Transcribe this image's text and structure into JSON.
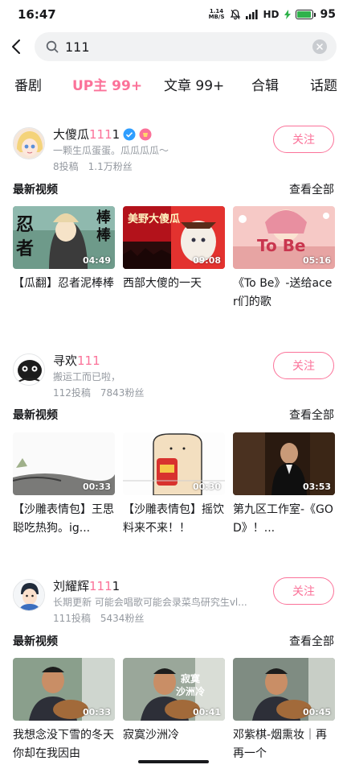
{
  "status_bar": {
    "time": "16:47",
    "speed_value": "1.14",
    "speed_unit": "MB/S",
    "hd": "HD",
    "battery": "95",
    "battery_level": 0.95,
    "battery_color": "#2fb24b"
  },
  "search": {
    "query": "111",
    "back_icon": "back-arrow-icon",
    "search_icon": "search-icon",
    "clear_icon": "clear-icon"
  },
  "tabs": [
    {
      "label": "番剧",
      "active": false
    },
    {
      "label": "UP主 99+",
      "active": true
    },
    {
      "label": "文章 99+",
      "active": false
    },
    {
      "label": "合辑",
      "active": false
    },
    {
      "label": "话题",
      "active": false
    }
  ],
  "accent_color": "#fb7299",
  "results": [
    {
      "name_prefix": "大傻瓜",
      "name_highlight": "111",
      "name_suffix": "1",
      "signature": "一颗生瓜蛋蛋。瓜瓜瓜瓜～",
      "videos_count": "8投稿",
      "fans": "1.1万粉丝",
      "follow_label": "关注",
      "section_title": "最新视频",
      "see_all": "查看全部",
      "videos": [
        {
          "title": "【瓜翻】忍者泥棒棒",
          "duration": "04:49",
          "thumb_text": [
            "忍",
            "者",
            "泥",
            "棒",
            "棒"
          ]
        },
        {
          "title": "西部大傻的一天",
          "duration": "09:08",
          "thumb_text": [
            "美野大傻瓜"
          ]
        },
        {
          "title": "《To Be》-送给acer们的歌",
          "duration": "05:16",
          "thumb_text": [
            "To Be"
          ]
        }
      ]
    },
    {
      "name_prefix": "寻欢",
      "name_highlight": "111",
      "name_suffix": "",
      "signature": "搬运工而已啦，",
      "videos_count": "112投稿",
      "fans": "7843粉丝",
      "follow_label": "关注",
      "section_title": "最新视频",
      "see_all": "查看全部",
      "videos": [
        {
          "title": "【沙雕表情包】王思聪吃热狗。ig...",
          "duration": "00:33",
          "thumb_text": []
        },
        {
          "title": "【沙雕表情包】摇饮料来不来！！",
          "duration": "00:30",
          "thumb_text": []
        },
        {
          "title": "第九区工作室-《GOD》！...",
          "duration": "03:53",
          "thumb_text": []
        }
      ]
    },
    {
      "name_prefix": "刘耀辉",
      "name_highlight": "111",
      "name_suffix": "1",
      "signature": "长期更新 可能会唱歌可能会录菜鸟研究生vl...",
      "videos_count": "111投稿",
      "fans": "5434粉丝",
      "follow_label": "关注",
      "section_title": "最新视频",
      "see_all": "查看全部",
      "videos": [
        {
          "title": "我想念没下雪的冬天 你却在我因由",
          "duration": "00:33",
          "thumb_text": []
        },
        {
          "title": "寂寞沙洲冷",
          "duration": "00:41",
          "thumb_text": [
            "寂寞",
            "沙洲冷"
          ]
        },
        {
          "title": "邓紫棋-烟熏妆｜再再一个",
          "duration": "00:45",
          "thumb_text": []
        }
      ]
    }
  ]
}
